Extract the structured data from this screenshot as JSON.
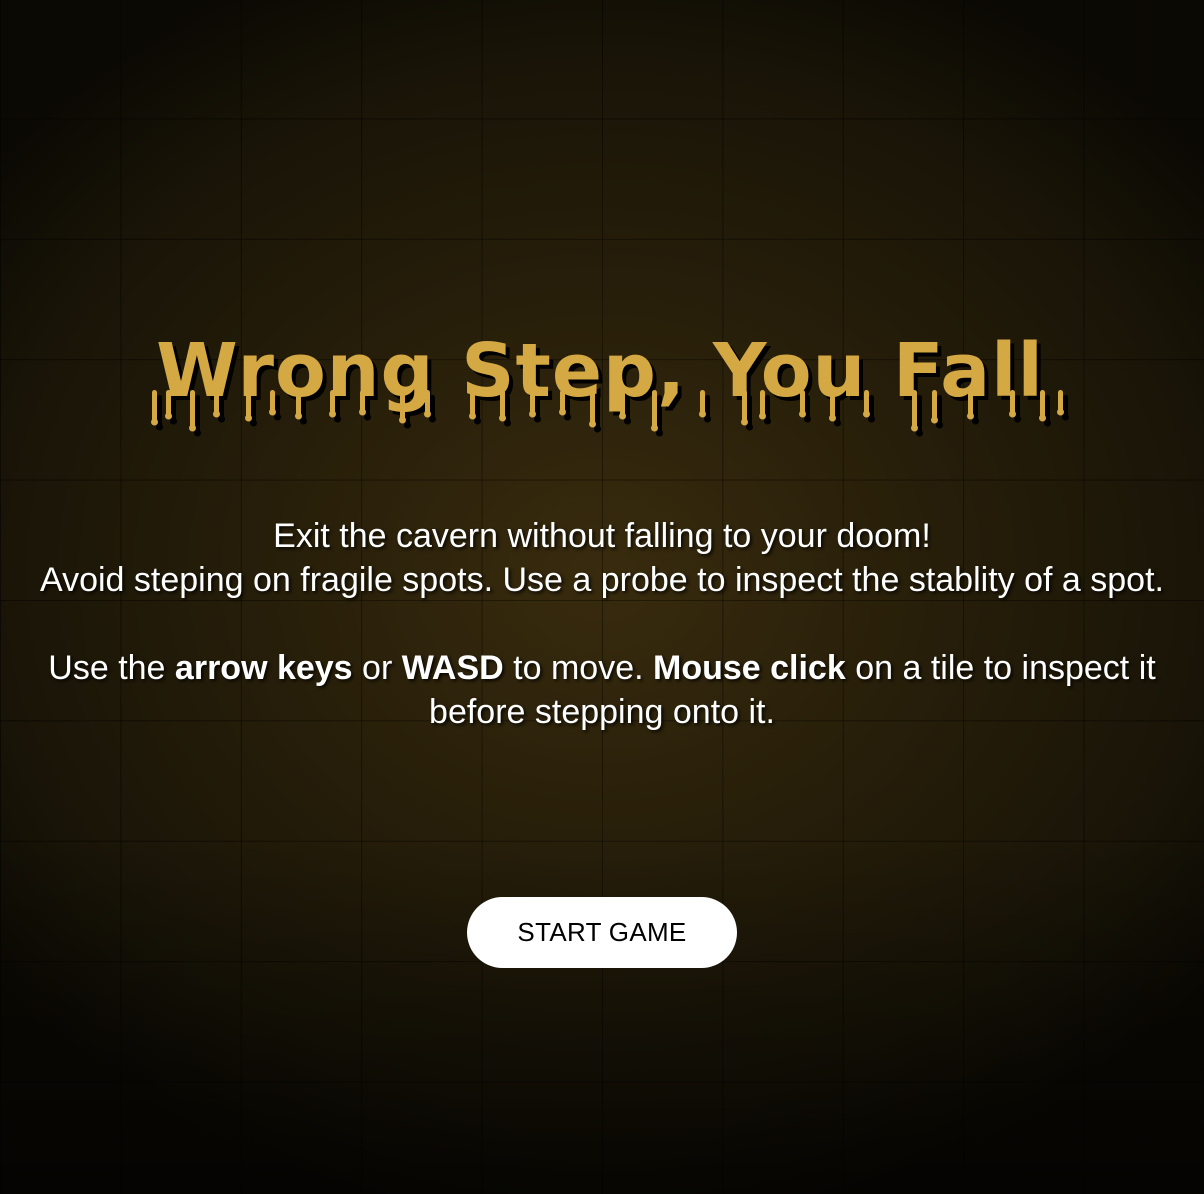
{
  "title": "Wrong Step, You Fall",
  "colors": {
    "title": "#d4a843",
    "title_shadow": "#000000",
    "background": "#1b1608",
    "grid_line": "#0d0b04",
    "text": "#ffffff",
    "button_bg": "#ffffff",
    "button_text": "#000000"
  },
  "intro": {
    "line1": "Exit the cavern without falling to your doom!",
    "line2": "Avoid steping on fragile spots. Use a probe to inspect the stablity of a spot.",
    "controls": {
      "part1": "Use the ",
      "key1": "arrow keys",
      "part2": " or ",
      "key2": "WASD",
      "part3": " to move. ",
      "key3": "Mouse click",
      "part4": " on a tile to inspect it before stepping onto it."
    }
  },
  "start_button": {
    "label": "START GAME"
  }
}
